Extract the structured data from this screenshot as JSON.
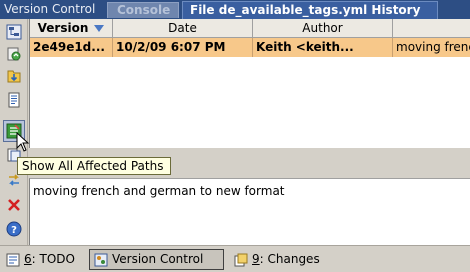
{
  "header": {
    "tool_title": "Version Control",
    "tab_console": "Console",
    "tab_history": "File de_available_tags.yml History"
  },
  "toolbar": {
    "tooltip": "Show All Affected Paths"
  },
  "table": {
    "columns": [
      "Version",
      "Date",
      "Author"
    ],
    "rows": [
      {
        "version": "2e49e1d...",
        "date": "10/2/09 6:07 PM",
        "author": "Keith <keith...",
        "message": "moving french a"
      }
    ]
  },
  "comment": {
    "text": "moving french and german to new format"
  },
  "statusbar": {
    "todo_key": "6",
    "todo_label": ": TODO",
    "vc_label": "Version Control",
    "changes_key": "9",
    "changes_label": ": Changes"
  },
  "colors": {
    "title_bar": "#2d4e84",
    "selected_row": "#f7c88a",
    "tooltip_bg": "#ffffe1"
  }
}
